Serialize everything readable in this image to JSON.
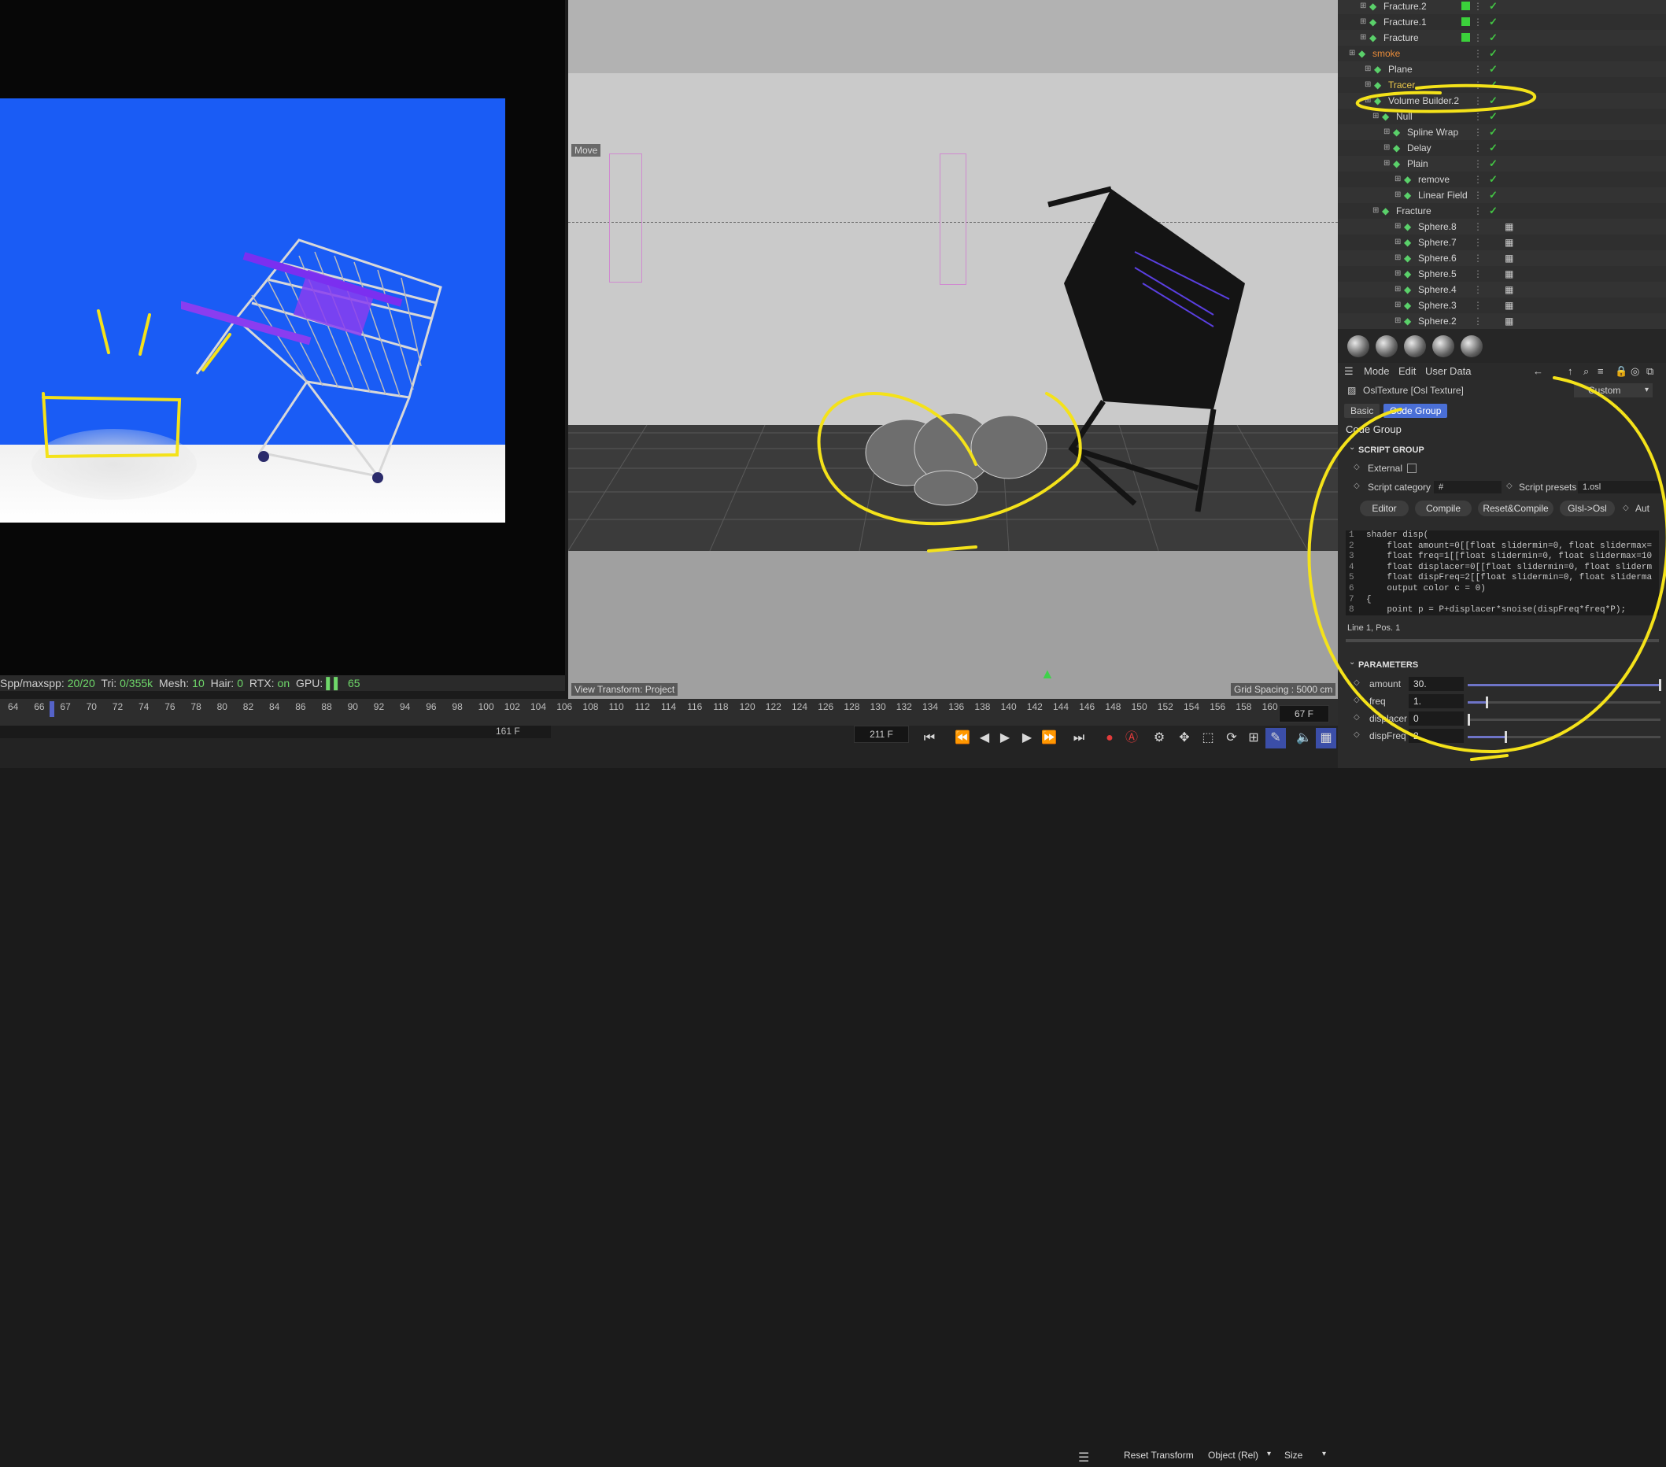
{
  "render_stats": {
    "spp_label": "Spp/maxspp:",
    "spp_value": "20/20",
    "tri_label": "Tri:",
    "tri_value": "0/355k",
    "mesh_label": "Mesh:",
    "mesh_value": "10",
    "hair_label": "Hair:",
    "hair_value": "0",
    "rtx_label": "RTX:",
    "rtx_value": "on",
    "gpu_label": "GPU:",
    "gpu_value": "65"
  },
  "viewport": {
    "tool_label": "Move",
    "view_transform": "View Transform: Project",
    "grid_spacing": "Grid Spacing : 5000 cm"
  },
  "timeline": {
    "ticks": [
      "64",
      "66",
      "67",
      "70",
      "72",
      "74",
      "76",
      "78",
      "80",
      "82",
      "84",
      "86",
      "88",
      "90",
      "92",
      "94",
      "96",
      "98",
      "100",
      "102",
      "104",
      "106",
      "108",
      "110",
      "112",
      "114",
      "116",
      "118",
      "120",
      "122",
      "124",
      "126",
      "128",
      "130",
      "132",
      "134",
      "136",
      "138",
      "140",
      "142",
      "144",
      "146",
      "148",
      "150",
      "152",
      "154",
      "156",
      "158",
      "160"
    ],
    "current_frame": "67 F",
    "end_frame_label": "161 F",
    "max_frame": "211 F",
    "reset_transform": "Reset Transform",
    "coord_mode": "Object (Rel)",
    "size_mode": "Size"
  },
  "object_manager": {
    "rows": [
      {
        "name": "Fracture.2",
        "indent": 28,
        "style": "",
        "green": true
      },
      {
        "name": "Fracture.1",
        "indent": 28,
        "style": "",
        "green": true
      },
      {
        "name": "Fracture",
        "indent": 28,
        "style": "",
        "green": true
      },
      {
        "name": "smoke",
        "indent": 14,
        "style": "orange",
        "green": false
      },
      {
        "name": "Plane",
        "indent": 34,
        "style": "",
        "green": false
      },
      {
        "name": "Tracer",
        "indent": 34,
        "style": "yellow",
        "green": false
      },
      {
        "name": "Volume Builder.2",
        "indent": 34,
        "style": "",
        "green": false
      },
      {
        "name": "Null",
        "indent": 44,
        "style": "",
        "green": false
      },
      {
        "name": "Spline Wrap",
        "indent": 58,
        "style": "",
        "green": false
      },
      {
        "name": "Delay",
        "indent": 58,
        "style": "",
        "green": false
      },
      {
        "name": "Plain",
        "indent": 58,
        "style": "",
        "green": false
      },
      {
        "name": "remove",
        "indent": 72,
        "style": "",
        "green": false
      },
      {
        "name": "Linear Field",
        "indent": 72,
        "style": "",
        "green": false
      },
      {
        "name": "Fracture",
        "indent": 44,
        "style": "",
        "green": false
      },
      {
        "name": "Sphere.8",
        "indent": 72,
        "style": "",
        "green": false
      },
      {
        "name": "Sphere.7",
        "indent": 72,
        "style": "",
        "green": false
      },
      {
        "name": "Sphere.6",
        "indent": 72,
        "style": "",
        "green": false
      },
      {
        "name": "Sphere.5",
        "indent": 72,
        "style": "",
        "green": false
      },
      {
        "name": "Sphere.4",
        "indent": 72,
        "style": "",
        "green": false
      },
      {
        "name": "Sphere.3",
        "indent": 72,
        "style": "",
        "green": false
      },
      {
        "name": "Sphere.2",
        "indent": 72,
        "style": "",
        "green": false
      }
    ]
  },
  "attributes": {
    "menu": {
      "mode": "Mode",
      "edit": "Edit",
      "user_data": "User Data"
    },
    "object_title": "OslTexture [Osl Texture]",
    "preset": "Custom",
    "tabs": {
      "basic": "Basic",
      "code_group": "Code Group"
    },
    "group_title": "Code Group",
    "script_group": {
      "title": "SCRIPT GROUP",
      "external_label": "External",
      "category_label": "Script category",
      "category_value": "#",
      "presets_label": "Script presets",
      "presets_value": "1.osl",
      "buttons": {
        "editor": "Editor",
        "compile": "Compile",
        "reset_compile": "Reset&Compile",
        "glsl_osl": "Glsl->Osl",
        "auto": "Aut"
      }
    },
    "code_lines": [
      {
        "n": "1",
        "text": "shader disp("
      },
      {
        "n": "2",
        "text": "    float amount=0[[float slidermin=0, float slidermax="
      },
      {
        "n": "3",
        "text": "    float freq=1[[float slidermin=0, float slidermax=10"
      },
      {
        "n": "4",
        "text": "    float displacer=0[[float slidermin=0, float sliderm"
      },
      {
        "n": "5",
        "text": "    float dispFreq=2[[float slidermin=0, float sliderma"
      },
      {
        "n": "6",
        "text": "    output color c = 0)"
      },
      {
        "n": "7",
        "text": "{"
      },
      {
        "n": "8",
        "text": "    point p = P+displacer*snoise(dispFreq*freq*P);"
      }
    ],
    "cursor_status": "Line 1, Pos. 1",
    "parameters": {
      "title": "PARAMETERS",
      "items": [
        {
          "label": "amount",
          "value": "30.",
          "fraction": 1.0
        },
        {
          "label": "freq",
          "value": "1.",
          "fraction": 0.1
        },
        {
          "label": "displacer",
          "value": "0",
          "fraction": 0.0
        },
        {
          "label": "dispFreq",
          "value": "2.",
          "fraction": 0.2
        }
      ]
    }
  },
  "colors": {
    "render_background": "#1a5cf5",
    "annotation": "#f4e21a",
    "accent_blue": "#4a6fd6",
    "check_green": "#43c444"
  }
}
